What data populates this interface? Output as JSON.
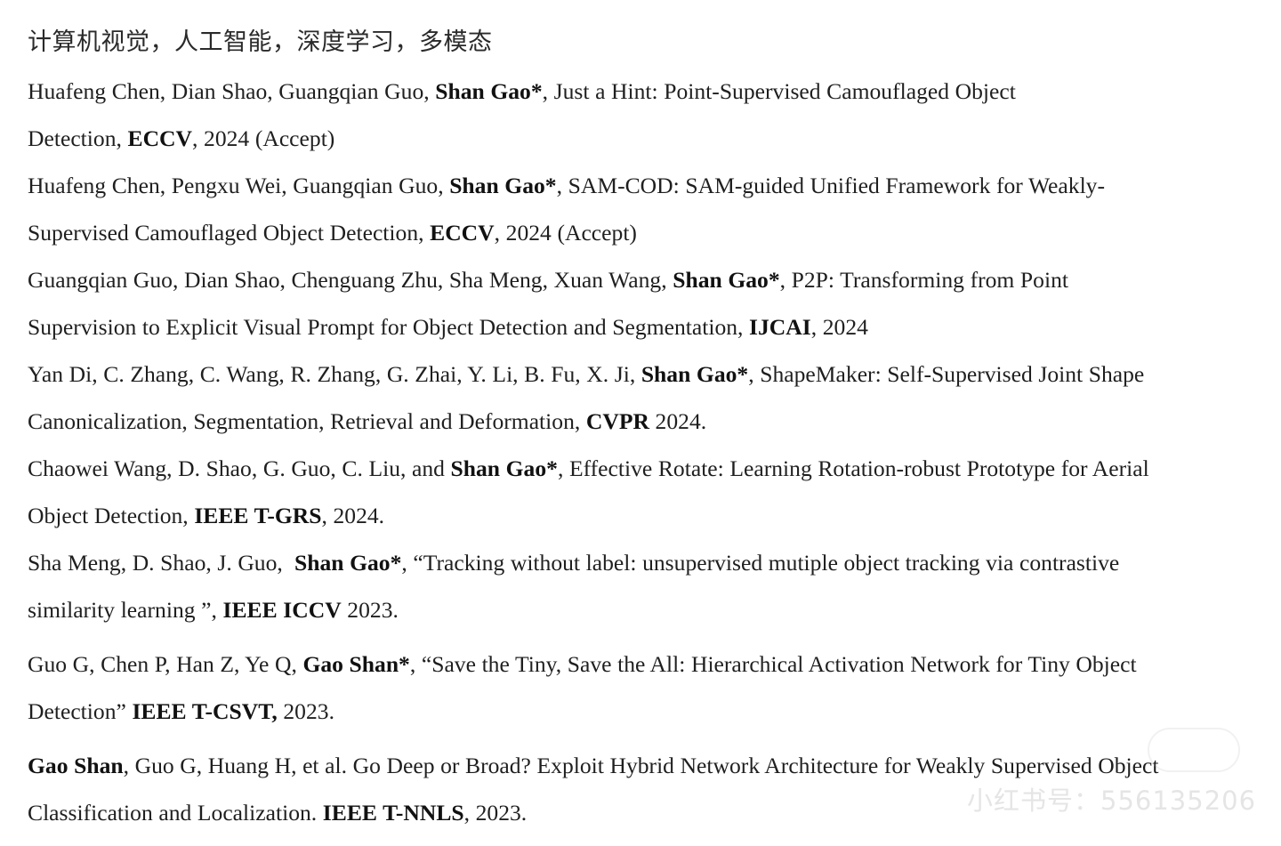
{
  "heading": "计算机视觉，人工智能，深度学习，多模态",
  "publications": [
    {
      "l1_a": "Huafeng Chen, Dian Shao, Guangqian Guo, ",
      "l1_b": "Shan Gao*",
      "l1_c": ", Just a Hint: Point-Supervised Camouflaged Object",
      "l2_a": "Detection, ",
      "l2_b": "ECCV",
      "l2_c": ", 2024 (Accept)"
    },
    {
      "l1_a": "Huafeng Chen, Pengxu Wei, Guangqian Guo, ",
      "l1_b": "Shan Gao*",
      "l1_c": ", SAM-COD: SAM-guided Unified Framework for Weakly-",
      "l2_a": "Supervised Camouflaged Object Detection, ",
      "l2_b": "ECCV",
      "l2_c": ", 2024 (Accept)"
    },
    {
      "l1_a": "Guangqian Guo, Dian Shao, Chenguang Zhu, Sha Meng, Xuan Wang, ",
      "l1_b": "Shan Gao*",
      "l1_c": ", P2P: Transforming from Point",
      "l2_a": "Supervision to Explicit Visual Prompt for Object Detection and Segmentation, ",
      "l2_b": "IJCAI",
      "l2_c": ", 2024"
    },
    {
      "l1_a": "Yan Di, C. Zhang, C. Wang, R. Zhang, G. Zhai, Y. Li, B. Fu, X. Ji, ",
      "l1_b": "Shan Gao*",
      "l1_c": ", ShapeMaker: Self-Supervised Joint Shape",
      "l2_a": "Canonicalization, Segmentation, Retrieval and Deformation, ",
      "l2_b": "CVPR",
      "l2_c": " 2024."
    },
    {
      "l1_a": "Chaowei Wang, D. Shao, G. Guo, C. Liu, and ",
      "l1_b": "Shan Gao*",
      "l1_c": ", Effective Rotate: Learning Rotation-robust Prototype for Aerial",
      "l2_a": "Object Detection, ",
      "l2_b": "IEEE T-GRS",
      "l2_c": ", 2024."
    },
    {
      "l1_a": "Sha Meng, D. Shao, J. Guo,  ",
      "l1_b": "Shan Gao*",
      "l1_c": ", “Tracking without label: unsupervised mutiple object tracking via contrastive",
      "l2_a": "similarity learning ”, ",
      "l2_b": "IEEE ICCV",
      "l2_c": " 2023."
    },
    {
      "l1_a": "Guo G, Chen P, Han Z, Ye Q, ",
      "l1_b": "Gao Shan*",
      "l1_c": ", “Save the Tiny, Save the All: Hierarchical Activation Network for Tiny Object",
      "l2_a": "Detection” ",
      "l2_b": "IEEE T-CSVT,",
      "l2_c": " 2023."
    },
    {
      "l1_a": "",
      "l1_b": "Gao Shan",
      "l1_c": ", Guo G, Huang H, et al. Go Deep or Broad? Exploit Hybrid Network Architecture for Weakly Supervised Object",
      "l2_a": "Classification and Localization. ",
      "l2_b": "IEEE T-NNLS",
      "l2_c": ", 2023."
    }
  ],
  "watermark": "小红书号：556135206"
}
